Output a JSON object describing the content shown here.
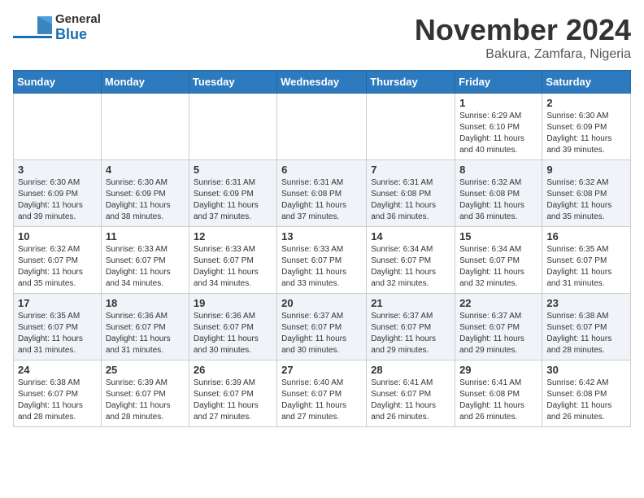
{
  "header": {
    "logo_general": "General",
    "logo_blue": "Blue",
    "month_title": "November 2024",
    "location": "Bakura, Zamfara, Nigeria"
  },
  "days_of_week": [
    "Sunday",
    "Monday",
    "Tuesday",
    "Wednesday",
    "Thursday",
    "Friday",
    "Saturday"
  ],
  "weeks": [
    {
      "days": [
        {
          "num": "",
          "info": ""
        },
        {
          "num": "",
          "info": ""
        },
        {
          "num": "",
          "info": ""
        },
        {
          "num": "",
          "info": ""
        },
        {
          "num": "",
          "info": ""
        },
        {
          "num": "1",
          "info": "Sunrise: 6:29 AM\nSunset: 6:10 PM\nDaylight: 11 hours and 40 minutes."
        },
        {
          "num": "2",
          "info": "Sunrise: 6:30 AM\nSunset: 6:09 PM\nDaylight: 11 hours and 39 minutes."
        }
      ]
    },
    {
      "days": [
        {
          "num": "3",
          "info": "Sunrise: 6:30 AM\nSunset: 6:09 PM\nDaylight: 11 hours and 39 minutes."
        },
        {
          "num": "4",
          "info": "Sunrise: 6:30 AM\nSunset: 6:09 PM\nDaylight: 11 hours and 38 minutes."
        },
        {
          "num": "5",
          "info": "Sunrise: 6:31 AM\nSunset: 6:09 PM\nDaylight: 11 hours and 37 minutes."
        },
        {
          "num": "6",
          "info": "Sunrise: 6:31 AM\nSunset: 6:08 PM\nDaylight: 11 hours and 37 minutes."
        },
        {
          "num": "7",
          "info": "Sunrise: 6:31 AM\nSunset: 6:08 PM\nDaylight: 11 hours and 36 minutes."
        },
        {
          "num": "8",
          "info": "Sunrise: 6:32 AM\nSunset: 6:08 PM\nDaylight: 11 hours and 36 minutes."
        },
        {
          "num": "9",
          "info": "Sunrise: 6:32 AM\nSunset: 6:08 PM\nDaylight: 11 hours and 35 minutes."
        }
      ]
    },
    {
      "days": [
        {
          "num": "10",
          "info": "Sunrise: 6:32 AM\nSunset: 6:07 PM\nDaylight: 11 hours and 35 minutes."
        },
        {
          "num": "11",
          "info": "Sunrise: 6:33 AM\nSunset: 6:07 PM\nDaylight: 11 hours and 34 minutes."
        },
        {
          "num": "12",
          "info": "Sunrise: 6:33 AM\nSunset: 6:07 PM\nDaylight: 11 hours and 34 minutes."
        },
        {
          "num": "13",
          "info": "Sunrise: 6:33 AM\nSunset: 6:07 PM\nDaylight: 11 hours and 33 minutes."
        },
        {
          "num": "14",
          "info": "Sunrise: 6:34 AM\nSunset: 6:07 PM\nDaylight: 11 hours and 32 minutes."
        },
        {
          "num": "15",
          "info": "Sunrise: 6:34 AM\nSunset: 6:07 PM\nDaylight: 11 hours and 32 minutes."
        },
        {
          "num": "16",
          "info": "Sunrise: 6:35 AM\nSunset: 6:07 PM\nDaylight: 11 hours and 31 minutes."
        }
      ]
    },
    {
      "days": [
        {
          "num": "17",
          "info": "Sunrise: 6:35 AM\nSunset: 6:07 PM\nDaylight: 11 hours and 31 minutes."
        },
        {
          "num": "18",
          "info": "Sunrise: 6:36 AM\nSunset: 6:07 PM\nDaylight: 11 hours and 31 minutes."
        },
        {
          "num": "19",
          "info": "Sunrise: 6:36 AM\nSunset: 6:07 PM\nDaylight: 11 hours and 30 minutes."
        },
        {
          "num": "20",
          "info": "Sunrise: 6:37 AM\nSunset: 6:07 PM\nDaylight: 11 hours and 30 minutes."
        },
        {
          "num": "21",
          "info": "Sunrise: 6:37 AM\nSunset: 6:07 PM\nDaylight: 11 hours and 29 minutes."
        },
        {
          "num": "22",
          "info": "Sunrise: 6:37 AM\nSunset: 6:07 PM\nDaylight: 11 hours and 29 minutes."
        },
        {
          "num": "23",
          "info": "Sunrise: 6:38 AM\nSunset: 6:07 PM\nDaylight: 11 hours and 28 minutes."
        }
      ]
    },
    {
      "days": [
        {
          "num": "24",
          "info": "Sunrise: 6:38 AM\nSunset: 6:07 PM\nDaylight: 11 hours and 28 minutes."
        },
        {
          "num": "25",
          "info": "Sunrise: 6:39 AM\nSunset: 6:07 PM\nDaylight: 11 hours and 28 minutes."
        },
        {
          "num": "26",
          "info": "Sunrise: 6:39 AM\nSunset: 6:07 PM\nDaylight: 11 hours and 27 minutes."
        },
        {
          "num": "27",
          "info": "Sunrise: 6:40 AM\nSunset: 6:07 PM\nDaylight: 11 hours and 27 minutes."
        },
        {
          "num": "28",
          "info": "Sunrise: 6:41 AM\nSunset: 6:07 PM\nDaylight: 11 hours and 26 minutes."
        },
        {
          "num": "29",
          "info": "Sunrise: 6:41 AM\nSunset: 6:08 PM\nDaylight: 11 hours and 26 minutes."
        },
        {
          "num": "30",
          "info": "Sunrise: 6:42 AM\nSunset: 6:08 PM\nDaylight: 11 hours and 26 minutes."
        }
      ]
    }
  ]
}
